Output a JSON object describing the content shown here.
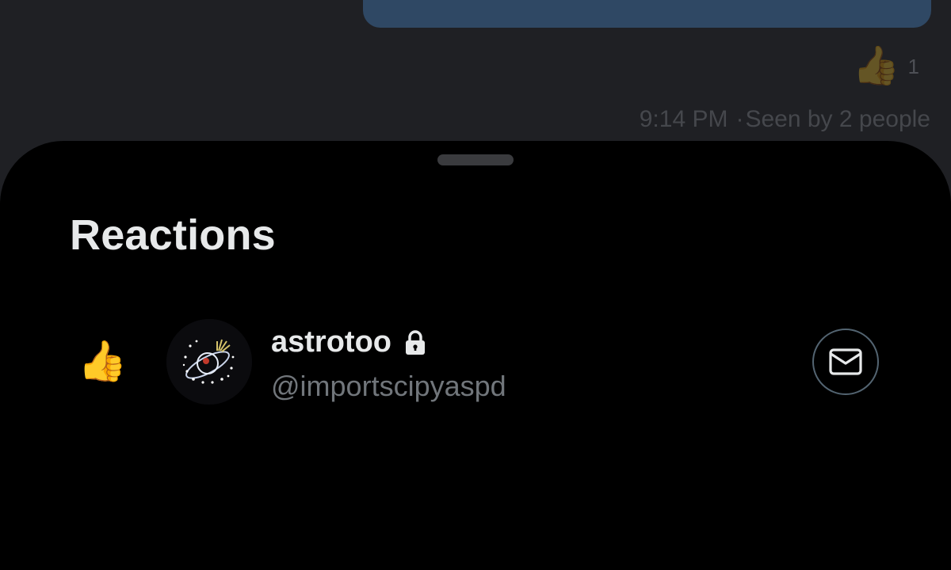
{
  "conversation": {
    "message_reaction": {
      "emoji": "👍",
      "count": "1"
    },
    "message_time": "9:14 PM",
    "seen_separator": "·",
    "seen_text": "Seen by 2 people"
  },
  "sheet": {
    "title": "Reactions",
    "reactions": [
      {
        "emoji": "👍",
        "display_name": "astrotoo",
        "handle": "@importscipyaspd",
        "protected_icon": "lock-icon",
        "action_icon": "envelope-icon"
      }
    ]
  },
  "colors": {
    "background": "#1f2024",
    "sheet": "#000000",
    "bubble": "#2f4864",
    "text_primary": "#e7e9ea",
    "text_secondary": "#71767b"
  }
}
